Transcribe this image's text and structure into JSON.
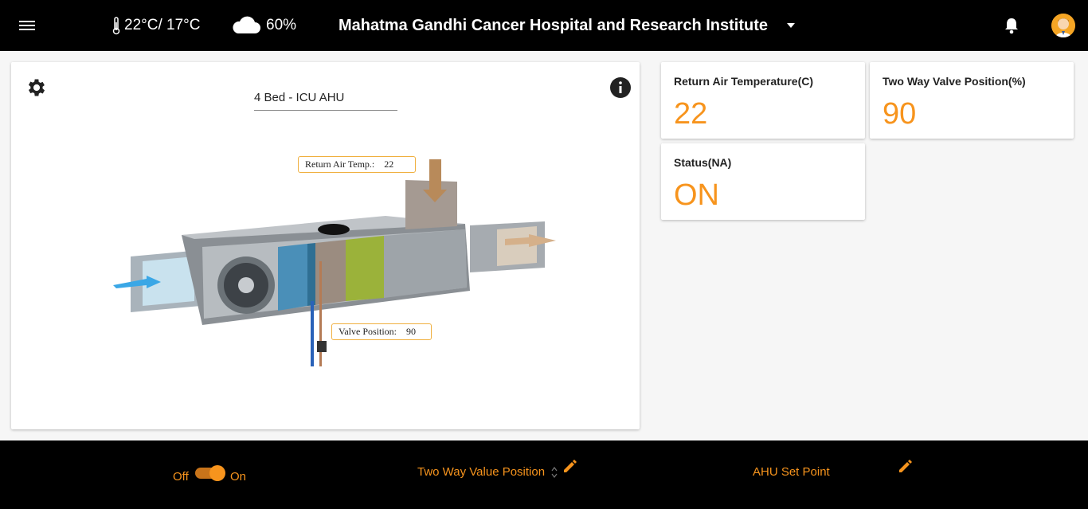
{
  "header": {
    "temperature": "22°C/ 17°C",
    "humidity": "60%",
    "hospital_name": "Mahatma Gandhi Cancer Hospital and Research Institute"
  },
  "panel": {
    "ahu_select_value": "4 Bed - ICU AHU",
    "return_air_tag_label": "Return Air Temp.:",
    "return_air_tag_value": "22",
    "valve_tag_label": "Valve Position:",
    "valve_tag_value": "90"
  },
  "cards": {
    "return_air": {
      "label": "Return Air Temperature(C)",
      "value": "22"
    },
    "valve": {
      "label": "Two Way Valve Position(%)",
      "value": "90"
    },
    "status": {
      "label": "Status(NA)",
      "value": "ON"
    }
  },
  "bottom": {
    "off_label": "Off",
    "on_label": "On",
    "valve_control_label": "Two Way Value Position",
    "setpoint_label": "AHU Set Point",
    "toggle_state": "on"
  },
  "colors": {
    "accent": "#f7941d",
    "header_bg": "#000000",
    "page_bg": "#f6f6f6"
  },
  "icons": [
    "menu-icon",
    "thermometer-icon",
    "cloud-icon",
    "dropdown-arrow-icon",
    "bell-icon",
    "avatar",
    "gear-icon",
    "info-icon",
    "edit-icon",
    "sort-icon"
  ]
}
